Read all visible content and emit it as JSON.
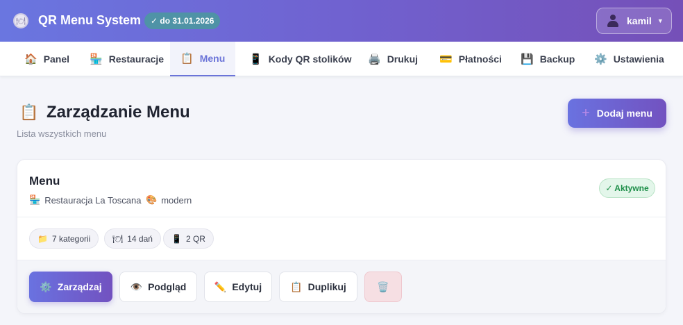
{
  "header": {
    "title": "QR Menu System",
    "license_badge": "✓ do 31.01.2026",
    "user": {
      "name": "kamil"
    }
  },
  "nav": {
    "items": [
      {
        "label": "Panel",
        "icon": "🏠"
      },
      {
        "label": "Restauracje",
        "icon": "🏪"
      },
      {
        "label": "Menu",
        "icon": "📋",
        "active": true
      },
      {
        "label": "Kody QR stolików",
        "icon": "📱"
      },
      {
        "label": "Drukuj",
        "icon": "🖨️"
      },
      {
        "label": "Płatności",
        "icon": "💳"
      },
      {
        "label": "Backup",
        "icon": "💾"
      },
      {
        "label": "Ustawienia",
        "icon": "⚙️"
      }
    ]
  },
  "page": {
    "title": "Zarządzanie Menu",
    "subtitle": "Lista wszystkich menu",
    "add_button": "Dodaj menu"
  },
  "menu_card": {
    "title": "Menu",
    "restaurant": "Restauracja La Toscana",
    "theme": "modern",
    "status": "✓ Aktywne",
    "stats": [
      "7 kategorii",
      "14 dań",
      "2 QR"
    ],
    "actions": {
      "manage": "Zarządzaj",
      "preview": "Podgląd",
      "edit": "Edytuj",
      "duplicate": "Duplikuj"
    }
  },
  "colors": {
    "accent": "#6b74d8",
    "header_gradient_start": "#6a76e0",
    "header_gradient_end": "#7550b8",
    "status_green": "#1f8f4a",
    "danger_bg": "#f6dfe3"
  }
}
